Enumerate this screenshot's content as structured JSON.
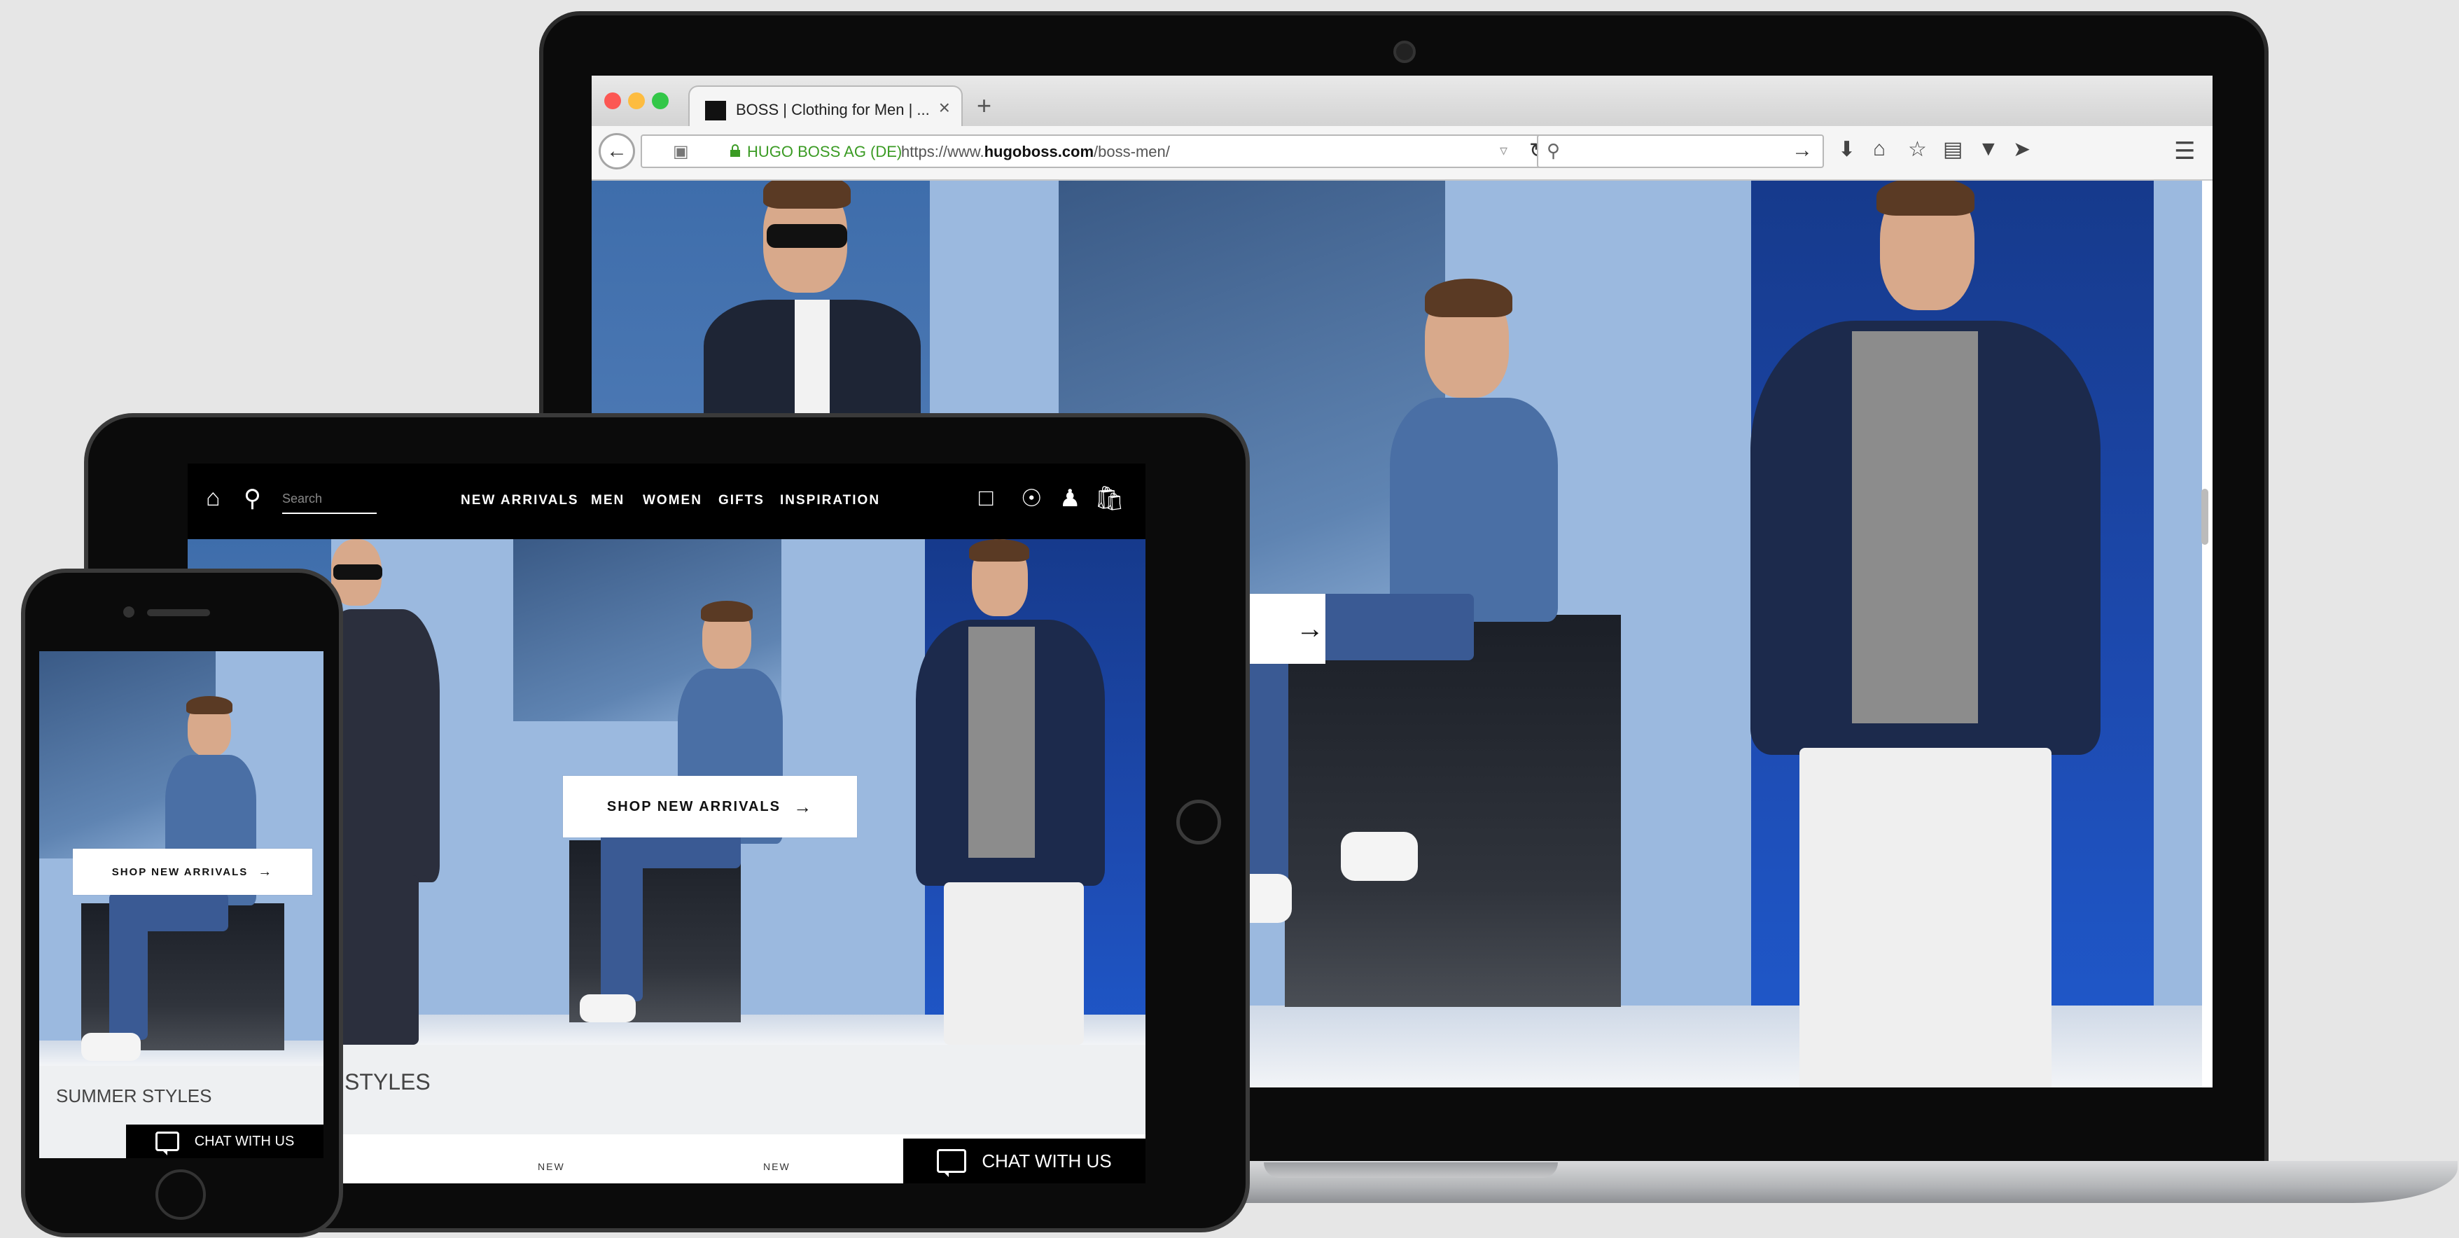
{
  "browser": {
    "tab_title": "BOSS | Clothing for Men | ...",
    "tab_close": "×",
    "new_tab": "+",
    "site_identity": "HUGO BOSS AG (DE)",
    "url_prefix": "https://www.",
    "url_domain": "hugoboss.com",
    "url_path": "/boss-men/",
    "search_placeholder": ""
  },
  "icons": {
    "back": "back-arrow-icon",
    "reload": "reload-icon",
    "download": "download-icon",
    "home": "home-icon",
    "bookmark": "star-icon",
    "reading": "reading-list-icon",
    "pocket": "pocket-icon",
    "send": "send-icon",
    "menu": "hamburger-menu-icon"
  },
  "site": {
    "cta_label": "SHOP NEW ARRIVALS",
    "cta_arrow": "→",
    "section_title": "SUMMER STYLES",
    "section_title_partial": "R STYLES",
    "chat_label": "CHAT WITH US",
    "new_tag": "NEW",
    "search_placeholder": "Search",
    "nav": [
      "NEW ARRIVALS",
      "MEN",
      "WOMEN",
      "GIFTS",
      "INSPIRATION"
    ]
  },
  "colors": {
    "secure_green": "#3b9b24",
    "brand_black": "#000000",
    "hero_blue": "#1d4ab0"
  }
}
